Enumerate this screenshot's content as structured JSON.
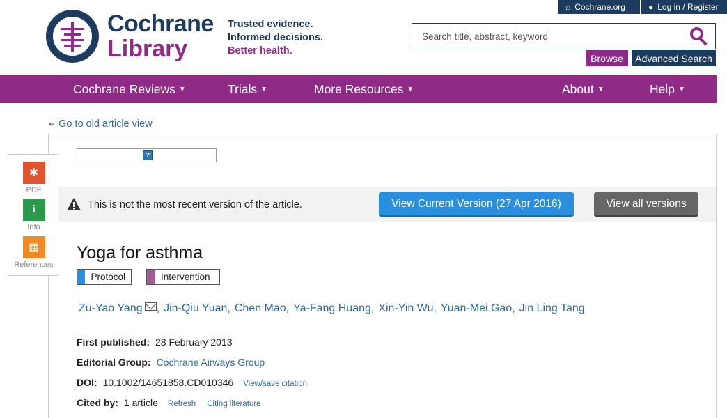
{
  "utility": {
    "cochrane_org": "Cochrane.org",
    "login": "Log in / Register"
  },
  "logo": {
    "line1": "Cochrane",
    "line2": "Library"
  },
  "tagline": {
    "line1": "Trusted evidence.",
    "line2": "Informed decisions.",
    "line3": "Better health."
  },
  "search": {
    "placeholder": "Search title, abstract, keyword",
    "browse_label": "Browse",
    "advanced_label": "Advanced Search"
  },
  "nav": {
    "items": [
      {
        "label": "Cochrane Reviews"
      },
      {
        "label": "Trials"
      },
      {
        "label": "More Resources"
      },
      {
        "label": "About"
      },
      {
        "label": "Help"
      }
    ]
  },
  "old_view": {
    "label": "Go to old article view"
  },
  "side_tools": [
    {
      "label": "PDF",
      "icon": "pdf-icon",
      "color": "#e0532f"
    },
    {
      "label": "Info",
      "icon": "info-icon",
      "color": "#2a9a4a"
    },
    {
      "label": "References",
      "icon": "references-icon",
      "color": "#f08a24"
    }
  ],
  "notice": {
    "text": "This is not the most recent version of the article.",
    "current_label": "View Current Version (27 Apr 2016)",
    "all_versions_label": "View all versions"
  },
  "article": {
    "title": "Yoga for asthma",
    "tags": [
      {
        "label": "Protocol",
        "color": "#2b8fe0"
      },
      {
        "label": "Intervention",
        "color": "#a25e8f"
      }
    ],
    "authors": [
      "Zu-Yao Yang",
      "Jin-Qiu Yuan,",
      "Chen Mao,",
      "Ya-Fang Huang,",
      "Xin-Yin Wu,",
      "Yuan-Mei Gao,",
      "Jin Ling Tang"
    ],
    "first_published_label": "First published:",
    "first_published": "28 February 2013",
    "editorial_group_label": "Editorial Group:",
    "editorial_group": "Cochrane Airways Group",
    "doi_label": "DOI:",
    "doi": "10.1002/14651858.CD010346",
    "view_citation": "View/save citation",
    "cited_by_label": "Cited by:",
    "cited_by": "1 article",
    "refresh": "Refresh",
    "citing_literature": "Citing literature"
  },
  "colors": {
    "navy": "#1d3b5e",
    "purple": "#8f2a86",
    "link": "#2c6aa0",
    "button_blue": "#2b8fe0"
  }
}
